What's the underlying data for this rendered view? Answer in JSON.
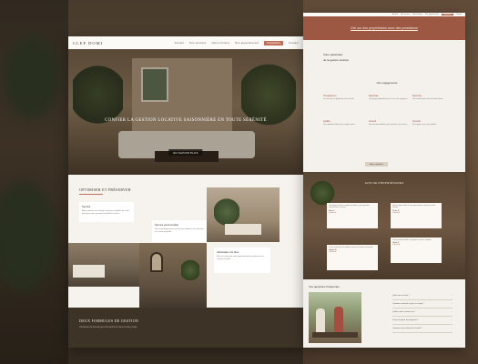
{
  "left_page": {
    "logo": "CLEF DOMI",
    "nav": [
      "Accueil",
      "Nos services",
      "Notre histoire",
      "Nos appartements",
      "Propriétaires",
      "Contact"
    ],
    "hero": {
      "title": "CONFIER LA GESTION LOCATIVE SAISONNIÈRE EN TOUTE SÉRÉNITÉ",
      "button": "EN SAVOIR PLUS"
    },
    "services": {
      "title": "OPTIMISER ET PRÉSERVER",
      "cards": [
        {
          "title": "Service",
          "text": "Nous prenons en charge la gestion complète de votre bien pour vous garantir tranquillité d'esprit."
        },
        {
          "title": "Service personnalisé",
          "text": "Un accompagnement sur mesure adapté à vos besoins et à votre propriété."
        },
        {
          "title": "Valorisation du bien",
          "text": "Mise en valeur de votre logement pour maximiser vos revenus locatifs."
        }
      ]
    },
    "formula": {
      "title": "DEUX FORMULES DE GESTION",
      "subtitle": "Choisissez la formule qui correspond le mieux à votre projet"
    }
  },
  "right_page": {
    "topbar": [
      "Accueil",
      "Nos services",
      "Notre histoire",
      "Nos appartements",
      "Contact"
    ],
    "topbar_cta": "Propriétaires",
    "banner": "Ciel sur des propriétaires avec des prestations",
    "section": {
      "title": "Votre partenaire",
      "subtitle": "de la gestion locative",
      "mid_title": "Nos engagements",
      "features": [
        {
          "title": "Transparence",
          "text": "Un suivi clair et régulier de votre activité."
        },
        {
          "title": "Réactivité",
          "text": "Une équipe disponible pour vous et vos voyageurs."
        },
        {
          "title": "Expertise",
          "text": "Une connaissance fine du marché local."
        },
        {
          "title": "Qualité",
          "text": "Des standards élevés pour chaque séjour."
        },
        {
          "title": "Conseil",
          "text": "Des recommandations pour optimiser vos revenus."
        },
        {
          "title": "Sérénité",
          "text": "Nous gérons tout, vous profitez."
        }
      ],
      "button": "Nous contacter"
    },
    "testimonials": {
      "title": "AVIS DE PROPRIÉTAIRES",
      "items": [
        {
          "quote": "Une équipe attentive et professionnelle, je recommande vivement leurs services.",
          "name": "Marie L.",
          "stars": "★★★★★"
        },
        {
          "quote": "Gestion impeccable de mon appartement, revenus en nette hausse.",
          "name": "Pierre D.",
          "stars": "★★★★★"
        },
        {
          "quote": "Un vrai partenaire de confiance pour ma location saisonnière.",
          "name": "Sophie M.",
          "stars": "★★★★★"
        },
        {
          "quote": "Communication fluide et voyageurs toujours satisfaits.",
          "name": "Julien R.",
          "stars": "★★★★★"
        }
      ]
    },
    "faq": {
      "title": "Vos questions fréquentes",
      "items": [
        "Quels sont vos tarifs ?",
        "Comment se déroule la prise en charge ?",
        "Quelles zones couvrez-vous ?",
        "Puis-je récupérer mon logement ?",
        "Comment suis-je informé de l'activité ?"
      ]
    }
  }
}
